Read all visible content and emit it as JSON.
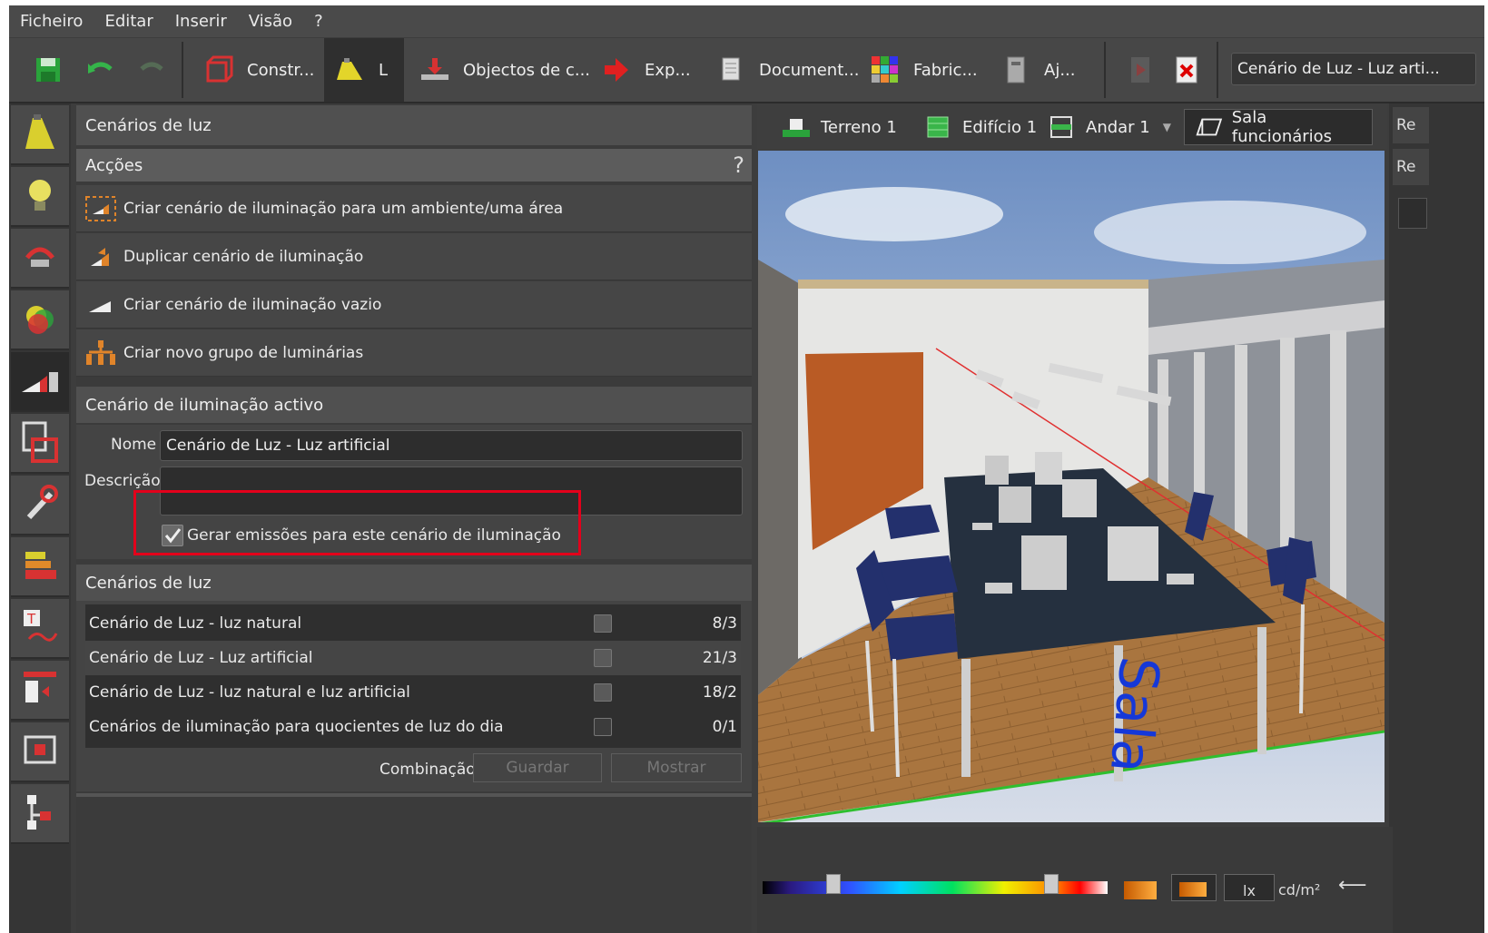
{
  "menu": [
    "Ficheiro",
    "Editar",
    "Inserir",
    "Visão",
    "?"
  ],
  "toolbar": {
    "tabs": [
      "Constr...",
      "L",
      "Objectos de c...",
      "Exp...",
      "Document...",
      "Fabric...",
      "Aj..."
    ],
    "scene_select": "Cenário de Luz - Luz arti..."
  },
  "panel": {
    "title": "Cenários de luz",
    "actions_header": "Acções",
    "help": "?",
    "actions": [
      "Criar cenário de iluminação para um ambiente/uma área",
      "Duplicar cenário de iluminação",
      "Criar cenário de iluminação vazio",
      "Criar novo grupo de luminárias"
    ],
    "active_header": "Cenário de iluminação activo",
    "name_label": "Nome",
    "name_value": "Cenário de Luz - Luz artificial",
    "desc_label": "Descrição",
    "desc_value": "",
    "emission_label": "Gerar emissões para este cenário de iluminação",
    "emission_checked": true,
    "scenes_header": "Cenários de luz",
    "scenes": [
      {
        "name": "Cenário de Luz  - luz natural",
        "count": "8/3"
      },
      {
        "name": "Cenário de Luz - Luz artificial",
        "count": "21/3"
      },
      {
        "name": "Cenário de Luz - luz natural e luz artificial",
        "count": "18/2"
      },
      {
        "name": "Cenários de iluminação para quocientes de luz do dia",
        "count": "0/1"
      }
    ],
    "combination_label": "Combinação",
    "save_label": "Guardar",
    "show_label": "Mostrar"
  },
  "viewtabs": {
    "terreno": "Terreno 1",
    "edificio": "Edifício 1",
    "andar": "Andar 1",
    "sala": "Sala funcionários"
  },
  "view3d": {
    "floor_text": "Sala"
  },
  "rightbar": {
    "item1": "Re",
    "item2": "Re"
  },
  "bottom": {
    "unit1": "lx",
    "unit2": "cd/m²"
  },
  "colors": {
    "accent_red": "#e3001b",
    "bg_dark": "#3d3d3d"
  }
}
